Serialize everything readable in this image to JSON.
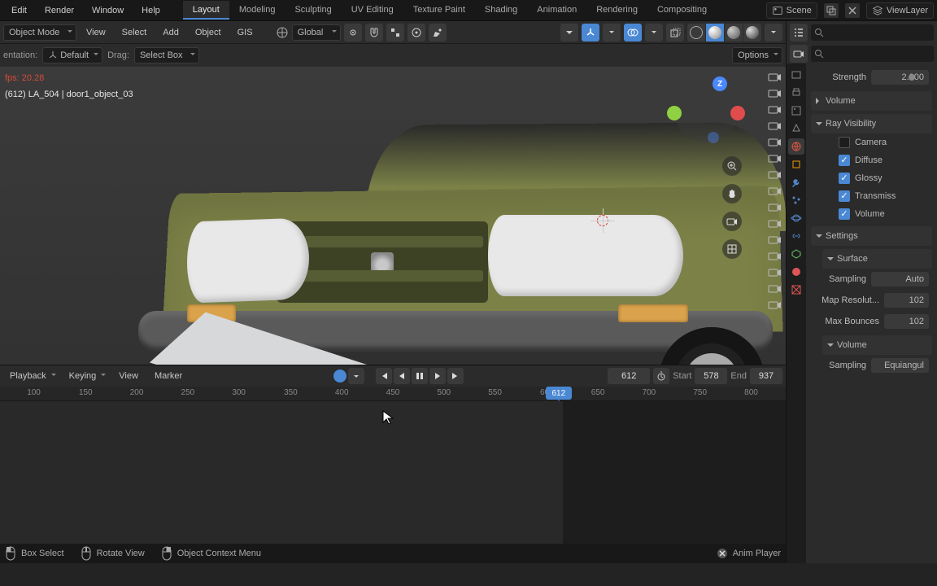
{
  "top_menus": [
    "Edit",
    "Render",
    "Window",
    "Help"
  ],
  "workspaces": [
    "Layout",
    "Modeling",
    "Sculpting",
    "UV Editing",
    "Texture Paint",
    "Shading",
    "Animation",
    "Rendering",
    "Compositing"
  ],
  "active_workspace": "Layout",
  "scene": {
    "label": "Scene"
  },
  "viewlayer": {
    "label": "ViewLayer"
  },
  "header": {
    "mode": "Object Mode",
    "menus": [
      "View",
      "Select",
      "Add",
      "Object",
      "GIS"
    ],
    "orient": "Global"
  },
  "subbar": {
    "orientation_label": "entation:",
    "orientation_value": "Default",
    "drag_label": "Drag:",
    "drag_value": "Select Box",
    "options": "Options"
  },
  "viewport": {
    "fps": "fps: 20.28",
    "object_label": "(612) LA_504 | door1_object_03",
    "axis_z": "Z"
  },
  "timeline": {
    "menus": [
      "Playback",
      "Keying",
      "View",
      "Marker"
    ],
    "current": "612",
    "start_label": "Start",
    "start": "578",
    "end_label": "End",
    "end": "937",
    "ticks": [
      "100",
      "150",
      "200",
      "250",
      "300",
      "350",
      "400",
      "450",
      "500",
      "550",
      "600",
      "650",
      "700",
      "750",
      "800"
    ],
    "playhead": "612"
  },
  "status": {
    "box_select": "Box Select",
    "rotate": "Rotate View",
    "ctx": "Object Context Menu",
    "anim": "Anim Player"
  },
  "props": {
    "strength_label": "Strength",
    "strength_value": "2.000",
    "volume": "Volume",
    "ray_vis": "Ray Visibility",
    "camera": "Camera",
    "diffuse": "Diffuse",
    "glossy": "Glossy",
    "transmiss": "Transmiss",
    "volume2": "Volume",
    "settings": "Settings",
    "surface": "Surface",
    "sampling": "Sampling",
    "sampling_value": "Auto",
    "map_res": "Map Resolut...",
    "map_res_val": "102",
    "max_bounces": "Max Bounces",
    "max_bounces_val": "102",
    "volume3": "Volume",
    "sampling2": "Sampling",
    "equi": "Equiangul"
  }
}
